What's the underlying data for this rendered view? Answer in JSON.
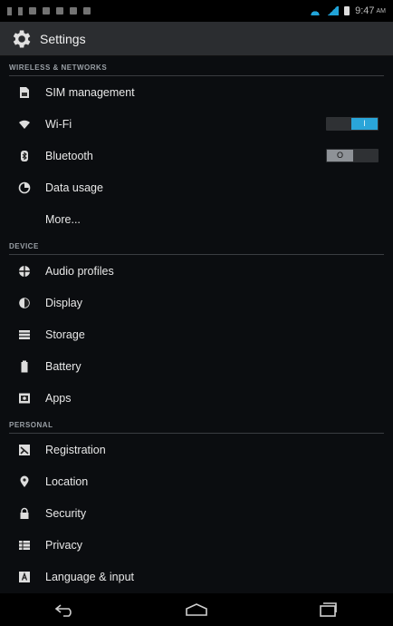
{
  "status_bar": {
    "time": "9:47",
    "ampm": "AM"
  },
  "app": {
    "title": "Settings"
  },
  "sections": {
    "wireless": "WIRELESS & NETWORKS",
    "device": "DEVICE",
    "personal": "PERSONAL"
  },
  "items": {
    "sim": "SIM management",
    "wifi": "Wi-Fi",
    "bluetooth": "Bluetooth",
    "data_usage": "Data usage",
    "more": "More...",
    "audio": "Audio profiles",
    "display": "Display",
    "storage": "Storage",
    "battery": "Battery",
    "apps": "Apps",
    "registration": "Registration",
    "location": "Location",
    "security": "Security",
    "privacy": "Privacy",
    "language": "Language & input"
  },
  "toggles": {
    "wifi": {
      "state": "on",
      "label": "I"
    },
    "bluetooth": {
      "state": "off",
      "label": "O"
    }
  },
  "colors": {
    "accent": "#2aa5d9",
    "background": "#0b0d10",
    "action_bar": "#2b2d30"
  },
  "icons": {
    "sim": "sim-card-icon",
    "wifi": "wifi-icon",
    "bluetooth": "bluetooth-icon",
    "data_usage": "data-usage-icon",
    "audio": "audio-profiles-icon",
    "display": "display-icon",
    "storage": "storage-icon",
    "battery": "battery-icon",
    "apps": "apps-icon",
    "registration": "registration-icon",
    "location": "location-pin-icon",
    "security": "lock-icon",
    "privacy": "privacy-icon",
    "language": "language-icon"
  }
}
